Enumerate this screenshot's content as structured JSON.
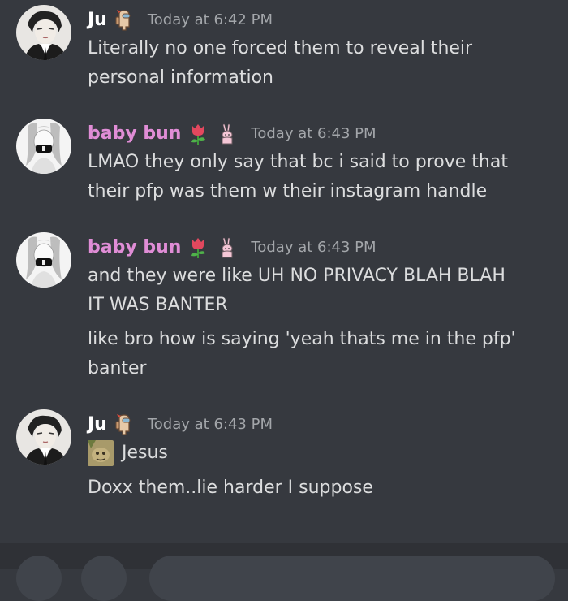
{
  "messages": [
    {
      "username": "Ju",
      "username_color": "#ffffff",
      "badge": "among-us-crewmate-icon",
      "timestamp": "Today at 6:42 PM",
      "lines": [
        "Literally no one forced them to reveal their",
        "personal information"
      ]
    },
    {
      "username": "baby bun",
      "username_color": "#e08dd6",
      "badges": [
        "tulip-icon",
        "pink-bunny-icon"
      ],
      "timestamp": "Today at 6:43 PM",
      "lines": [
        "LMAO they only say that bc i said to prove that",
        "their pfp was them w their instagram handle"
      ]
    },
    {
      "username": "baby bun",
      "username_color": "#e08dd6",
      "badges": [
        "tulip-icon",
        "pink-bunny-icon"
      ],
      "timestamp": "Today at 6:43 PM",
      "lines": [
        "and they were like UH NO PRIVACY BLAH BLAH",
        "IT WAS BANTER"
      ],
      "followup_lines": [
        "like bro how is saying 'yeah thats me in the pfp'",
        "banter"
      ]
    },
    {
      "username": "Ju",
      "username_color": "#ffffff",
      "badge": "among-us-crewmate-icon",
      "timestamp": "Today at 6:43 PM",
      "lines": [
        "Jesus"
      ],
      "followup_lines": [
        "Doxx them..lie harder I suppose"
      ]
    }
  ],
  "colors": {
    "background": "#36393f",
    "text": "#dcddde",
    "timestamp": "#a3a6aa"
  }
}
